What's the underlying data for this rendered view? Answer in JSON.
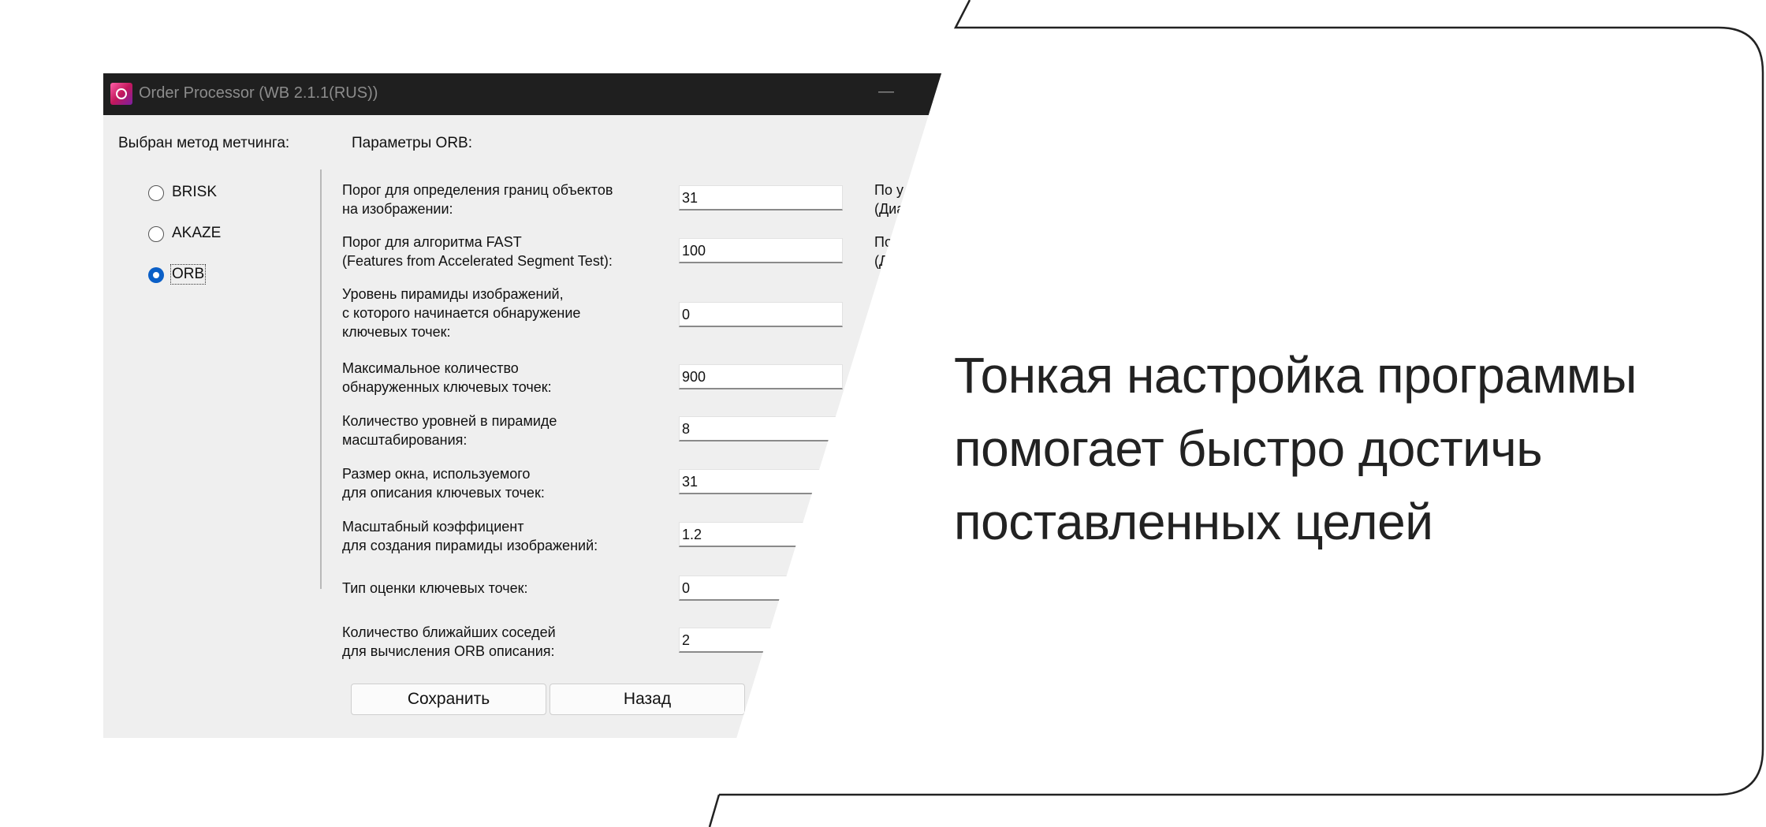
{
  "window": {
    "title": "Order Processor (WB 2.1.1(RUS))",
    "minimize_glyph": "—",
    "app_icon": "app-logo-icon"
  },
  "matching": {
    "heading": "Выбран метод метчинга:",
    "options": [
      {
        "label": "BRISK",
        "selected": false
      },
      {
        "label": "AKAZE",
        "selected": false
      },
      {
        "label": "ORB",
        "selected": true
      }
    ]
  },
  "params": {
    "heading": "Параметры ORB:",
    "rows": [
      {
        "label_lines": [
          "Порог для определения границ объектов",
          "на изображении:"
        ],
        "value": "31",
        "hint_lines": [
          "По у",
          "(Диа"
        ]
      },
      {
        "label_lines": [
          "Порог для алгоритма FAST",
          "(Features from Accelerated Segment Test):"
        ],
        "value": "100",
        "hint_lines": [
          "По",
          "(Д"
        ]
      },
      {
        "label_lines": [
          "Уровень пирамиды изображений,",
          "с которого начинается обнаружение",
          "ключевых точек:"
        ],
        "value": "0"
      },
      {
        "label_lines": [
          "Максимальное количество",
          "обнаруженных ключевых точек:"
        ],
        "value": "900"
      },
      {
        "label_lines": [
          "Количество уровней в пирамиде",
          "масштабирования:"
        ],
        "value": "8"
      },
      {
        "label_lines": [
          "Размер окна, используемого",
          "для описания ключевых точек:"
        ],
        "value": "31"
      },
      {
        "label_lines": [
          "Масштабный коэффициент",
          "для создания пирамиды изображений:"
        ],
        "value": "1.2"
      },
      {
        "label_lines": [
          "Тип оценки ключевых точек:"
        ],
        "value": "0"
      },
      {
        "label_lines": [
          "Количество ближайших соседей",
          "для вычисления ORB описания:"
        ],
        "value": "2"
      }
    ]
  },
  "buttons": {
    "save": "Сохранить",
    "back": "Назад"
  },
  "slide": {
    "tagline_lines": [
      "Тонкая настройка программы",
      "помогает быстро достичь",
      "поставленных целей"
    ],
    "border_color": "#222222",
    "radio_selected_color": "#0a5fc7"
  }
}
